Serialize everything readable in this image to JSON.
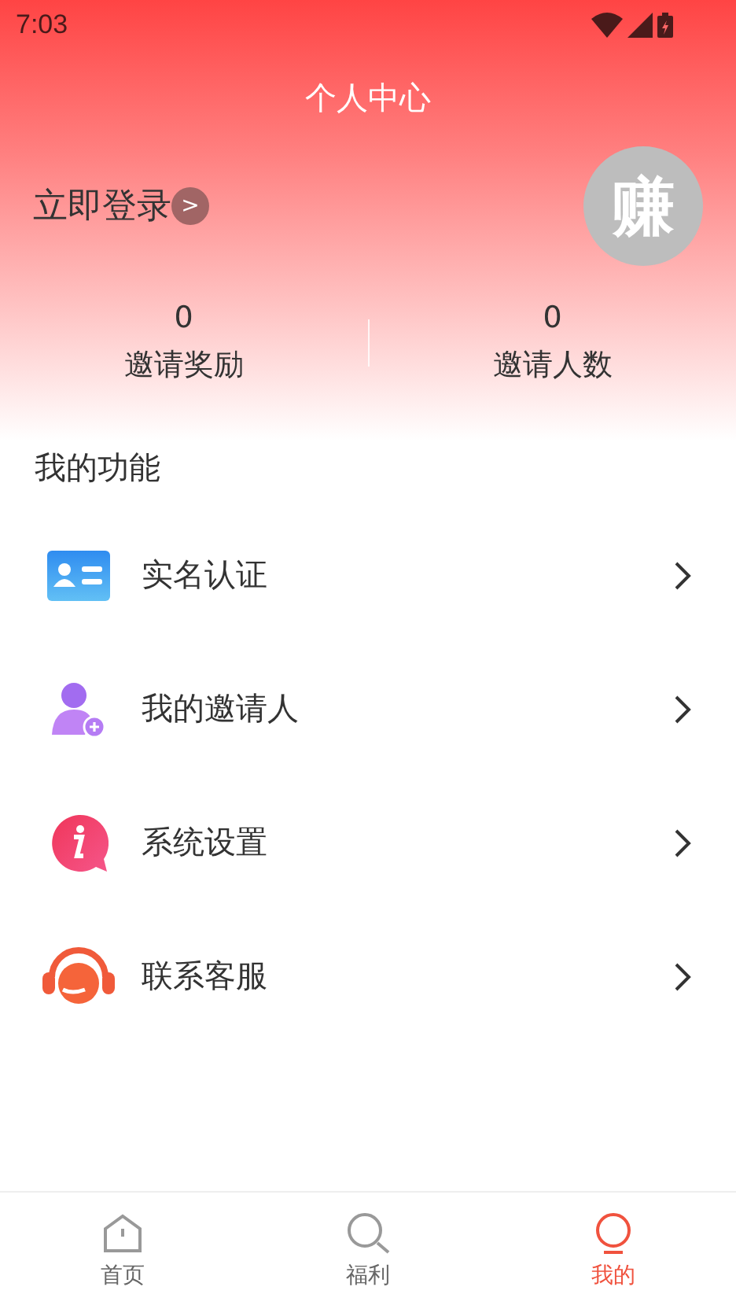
{
  "status_bar": {
    "time": "7:03"
  },
  "header": {
    "title": "个人中心",
    "login": "立即登录",
    "login_arrow": ">",
    "avatar_text": "赚"
  },
  "stats": [
    {
      "value": "0",
      "label": "邀请奖励"
    },
    {
      "value": "0",
      "label": "邀请人数"
    }
  ],
  "section_title": "我的功能",
  "menu": [
    {
      "kind": "id-card",
      "label": "实名认证"
    },
    {
      "kind": "person-add",
      "label": "我的邀请人"
    },
    {
      "kind": "info",
      "label": "系统设置"
    },
    {
      "kind": "headset",
      "label": "联系客服"
    }
  ],
  "tabs": [
    {
      "kind": "home",
      "label": "首页",
      "selected": false
    },
    {
      "kind": "search",
      "label": "福利",
      "selected": false
    },
    {
      "kind": "person",
      "label": "我的",
      "selected": true
    }
  ]
}
